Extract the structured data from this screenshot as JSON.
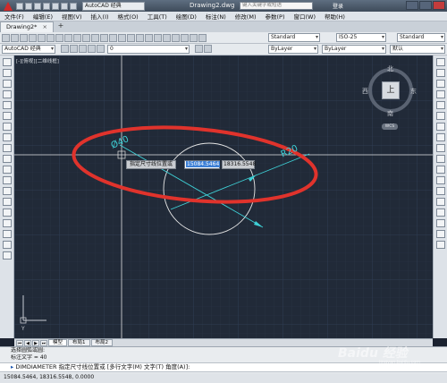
{
  "titlebar": {
    "workspace": "AutoCAD 经典",
    "title": "Drawing2.dwg",
    "search_placeholder": "键入关键字或短语",
    "login": "登录"
  },
  "menubar": {
    "items": [
      "文件(F)",
      "编辑(E)",
      "视图(V)",
      "插入(I)",
      "格式(O)",
      "工具(T)",
      "绘图(D)",
      "标注(N)",
      "修改(M)",
      "参数(P)",
      "窗口(W)",
      "帮助(H)"
    ]
  },
  "tabs": {
    "active": "Drawing2*"
  },
  "toolbar": {
    "workspace_combo": "AutoCAD 经典",
    "text_style": "Standard",
    "dim_style": "Standard",
    "dim_style_alt": "ISO-25",
    "table_style": "Standard",
    "layer_combo": "0",
    "color_combo": "ByLayer",
    "linetype_combo": "ByLayer",
    "lineweight_combo": "默认"
  },
  "viewport": {
    "label": "[-][俯视][二维线框]"
  },
  "drawing": {
    "diameter_text": "Ø40",
    "radius_text": "R20",
    "dyn_prompt": "指定尺寸线位置或",
    "dyn_x": "15084.5464",
    "dyn_y": "18316.5548"
  },
  "viewcube": {
    "north": "北",
    "south": "南",
    "west": "西",
    "east": "东",
    "top": "上",
    "wcs": "WCS"
  },
  "ucs": {
    "y_label": "Y"
  },
  "layout_tabs": [
    "模型",
    "布局1",
    "布局2"
  ],
  "command": {
    "history_1": "选择圆弧或圆:",
    "history_2": "标注文字 = 40",
    "input": "DIMDIAMETER 指定尺寸线位置或 [多行文字(M) 文字(T) 角度(A)]:"
  },
  "status": {
    "coords": "15084.5464, 18316.5548, 0.0000"
  },
  "watermark": {
    "brand": "Baidu 经验",
    "url": "jingyan.baidu.com"
  },
  "colors": {
    "canvas": "#212a38",
    "dimension": "#3ed0d6",
    "highlight_ellipse": "#e0332c",
    "circle": "#e6e6e6"
  }
}
